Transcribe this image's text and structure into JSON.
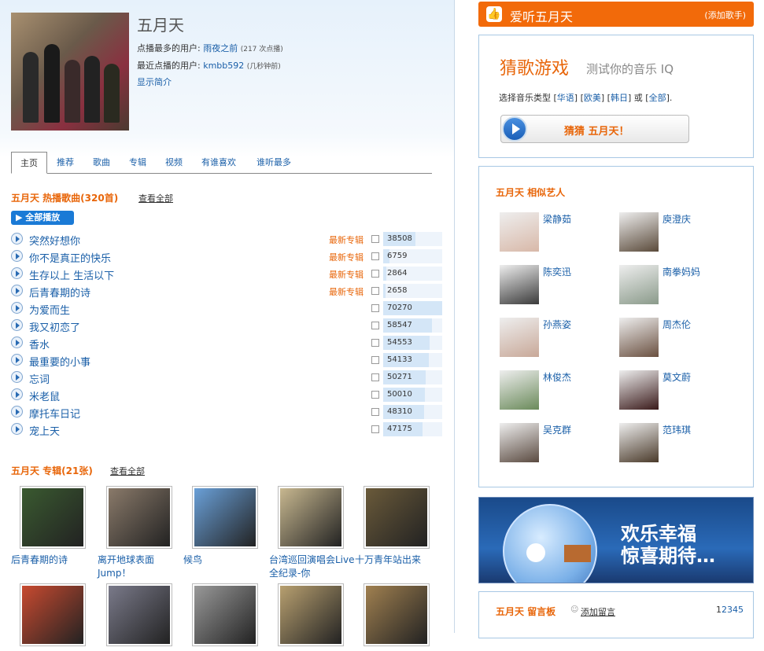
{
  "artist": {
    "name": "五月天",
    "top_user_label": "点播最多的用户:",
    "top_user": "雨夜之前",
    "top_user_count": "(217 次点播)",
    "recent_user_label": "最近点播的用户:",
    "recent_user": "kmbb592",
    "recent_user_time": "(几秒钟前)",
    "show_intro": "显示简介"
  },
  "tabs": [
    "主页",
    "推荐",
    "歌曲",
    "专辑",
    "视频",
    "有谁喜欢",
    "谁听最多"
  ],
  "songs_section": {
    "title": "五月天 热播歌曲(320首)",
    "view_all": "查看全部",
    "play_all": "全部播放",
    "new_label": "最新专辑"
  },
  "songs": [
    {
      "name": "突然好想你",
      "is_new": true,
      "plays": "38508",
      "level": 0.55
    },
    {
      "name": "你不是真正的快乐",
      "is_new": true,
      "plays": "6759",
      "level": 0.1
    },
    {
      "name": "生存以上 生活以下",
      "is_new": true,
      "plays": "2864",
      "level": 0.05
    },
    {
      "name": "后青春期的诗",
      "is_new": true,
      "plays": "2658",
      "level": 0.04
    },
    {
      "name": "为爱而生",
      "is_new": false,
      "plays": "70270",
      "level": 1.0
    },
    {
      "name": "我又初恋了",
      "is_new": false,
      "plays": "58547",
      "level": 0.83
    },
    {
      "name": "香水",
      "is_new": false,
      "plays": "54553",
      "level": 0.78
    },
    {
      "name": "最重要的小事",
      "is_new": false,
      "plays": "54133",
      "level": 0.77
    },
    {
      "name": "忘词",
      "is_new": false,
      "plays": "50271",
      "level": 0.72
    },
    {
      "name": "米老鼠",
      "is_new": false,
      "plays": "50010",
      "level": 0.71
    },
    {
      "name": "摩托车日记",
      "is_new": false,
      "plays": "48310",
      "level": 0.69
    },
    {
      "name": "宠上天",
      "is_new": false,
      "plays": "47175",
      "level": 0.67
    }
  ],
  "albums_section": {
    "title": "五月天 专辑(21张)",
    "view_all": "查看全部"
  },
  "albums": [
    {
      "title": "后青春期的诗",
      "color": "#3a5a30"
    },
    {
      "title": "离开地球表面Jump！",
      "color": "#8a7a6a"
    },
    {
      "title": "候鸟",
      "color": "#6aa0d8"
    },
    {
      "title": "台湾巡回演唱会Live全纪录-你",
      "color": "#c8b890"
    },
    {
      "title": "十万青年站出来",
      "color": "#6a5a3a"
    },
    {
      "title": "",
      "color": "#c84a30"
    },
    {
      "title": "",
      "color": "#7a7a8a"
    },
    {
      "title": "",
      "color": "#999999"
    },
    {
      "title": "",
      "color": "#b8a070"
    },
    {
      "title": "",
      "color": "#a08050"
    }
  ],
  "right": {
    "header_title": "爱听五月天",
    "add_singer": "(添加歌手)",
    "game_title": "猜歌游戏",
    "game_sub": "测试你的音乐 IQ",
    "select_type": "选择音乐类型",
    "types": [
      "华语",
      "欧美",
      "韩日",
      "全部"
    ],
    "or": "或",
    "guess_button": "猜猜 五月天！",
    "similar_title": "五月天 相似艺人",
    "banner_line1": "欢乐幸福",
    "banner_line2": "惊喜期待…",
    "board_title": "五月天 留言板",
    "add_message": "添加留言",
    "pages": [
      "1",
      "2",
      "3",
      "4",
      "5"
    ]
  },
  "similar": [
    {
      "name": "梁静茹",
      "color": "#d8b8a8"
    },
    {
      "name": "庾澄庆",
      "color": "#5a4a3a"
    },
    {
      "name": "陈奕迅",
      "color": "#3a3a3a"
    },
    {
      "name": "南拳妈妈",
      "color": "#8a9a8a"
    },
    {
      "name": "孙燕姿",
      "color": "#c8a898"
    },
    {
      "name": "周杰伦",
      "color": "#6a5040"
    },
    {
      "name": "林俊杰",
      "color": "#6a8a5a"
    },
    {
      "name": "莫文蔚",
      "color": "#3a1a1a"
    },
    {
      "name": "吴克群",
      "color": "#5a4a40"
    },
    {
      "name": "范玮琪",
      "color": "#4a3a2a"
    }
  ]
}
